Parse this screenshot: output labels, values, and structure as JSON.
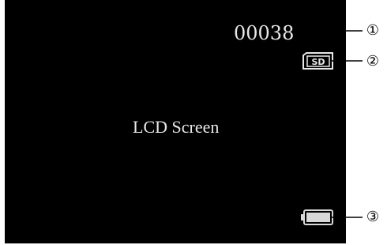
{
  "screen": {
    "label": "LCD Screen",
    "counter": "00038",
    "sd_text": "SD"
  },
  "callouts": [
    {
      "label": "①",
      "target": "counter"
    },
    {
      "label": "②",
      "target": "sd-card-icon"
    },
    {
      "label": "③",
      "target": "battery-icon"
    }
  ],
  "colors": {
    "screen_bg": "#000000",
    "screen_text": "#e8e8e8",
    "page_bg": "#ffffff",
    "line": "#000000"
  }
}
